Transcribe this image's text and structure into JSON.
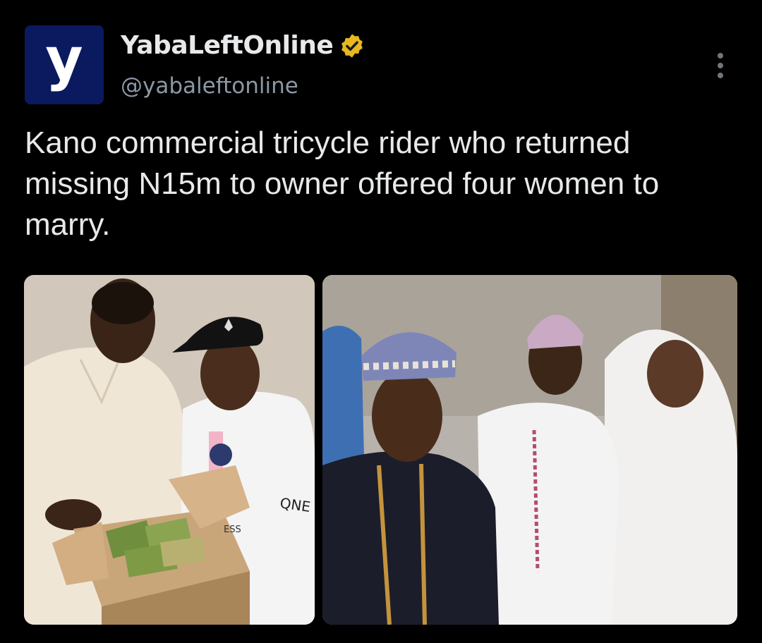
{
  "author": {
    "avatar_letter": "y",
    "display_name": "YabaLeftOnline",
    "handle": "@yabaleftonline",
    "verified": true,
    "verified_badge_color": "#e8b820"
  },
  "tweet": {
    "text": "Kano commercial tricycle rider who returned missing N15m to owner offered four women to marry."
  },
  "media": {
    "photo1_shirt_text": "QNE",
    "photo1_box_text": "ESS"
  },
  "icons": {
    "more": "more-vertical-icon",
    "verified": "verified-badge-icon"
  }
}
